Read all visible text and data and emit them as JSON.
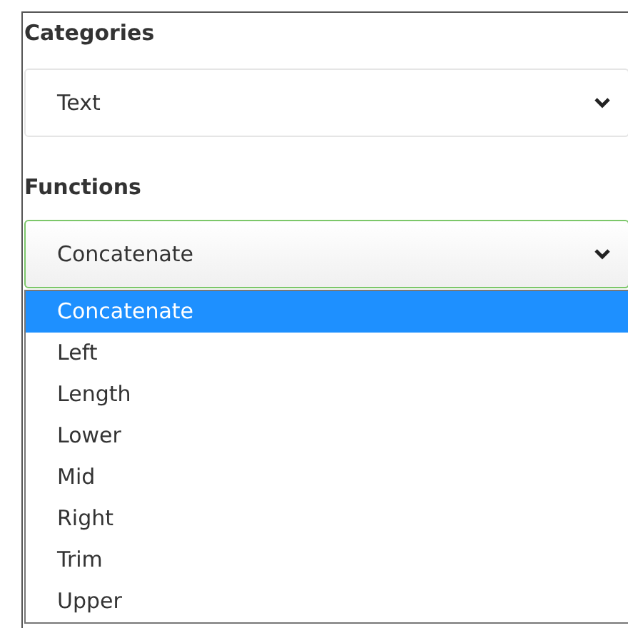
{
  "categories": {
    "label": "Categories",
    "value": "Text"
  },
  "functions": {
    "label": "Functions",
    "value": "Concatenate",
    "focused": true,
    "expanded": true,
    "options": [
      {
        "label": "Concatenate",
        "selected": true
      },
      {
        "label": "Left",
        "selected": false
      },
      {
        "label": "Length",
        "selected": false
      },
      {
        "label": "Lower",
        "selected": false
      },
      {
        "label": "Mid",
        "selected": false
      },
      {
        "label": "Right",
        "selected": false
      },
      {
        "label": "Trim",
        "selected": false
      },
      {
        "label": "Upper",
        "selected": false
      }
    ]
  }
}
